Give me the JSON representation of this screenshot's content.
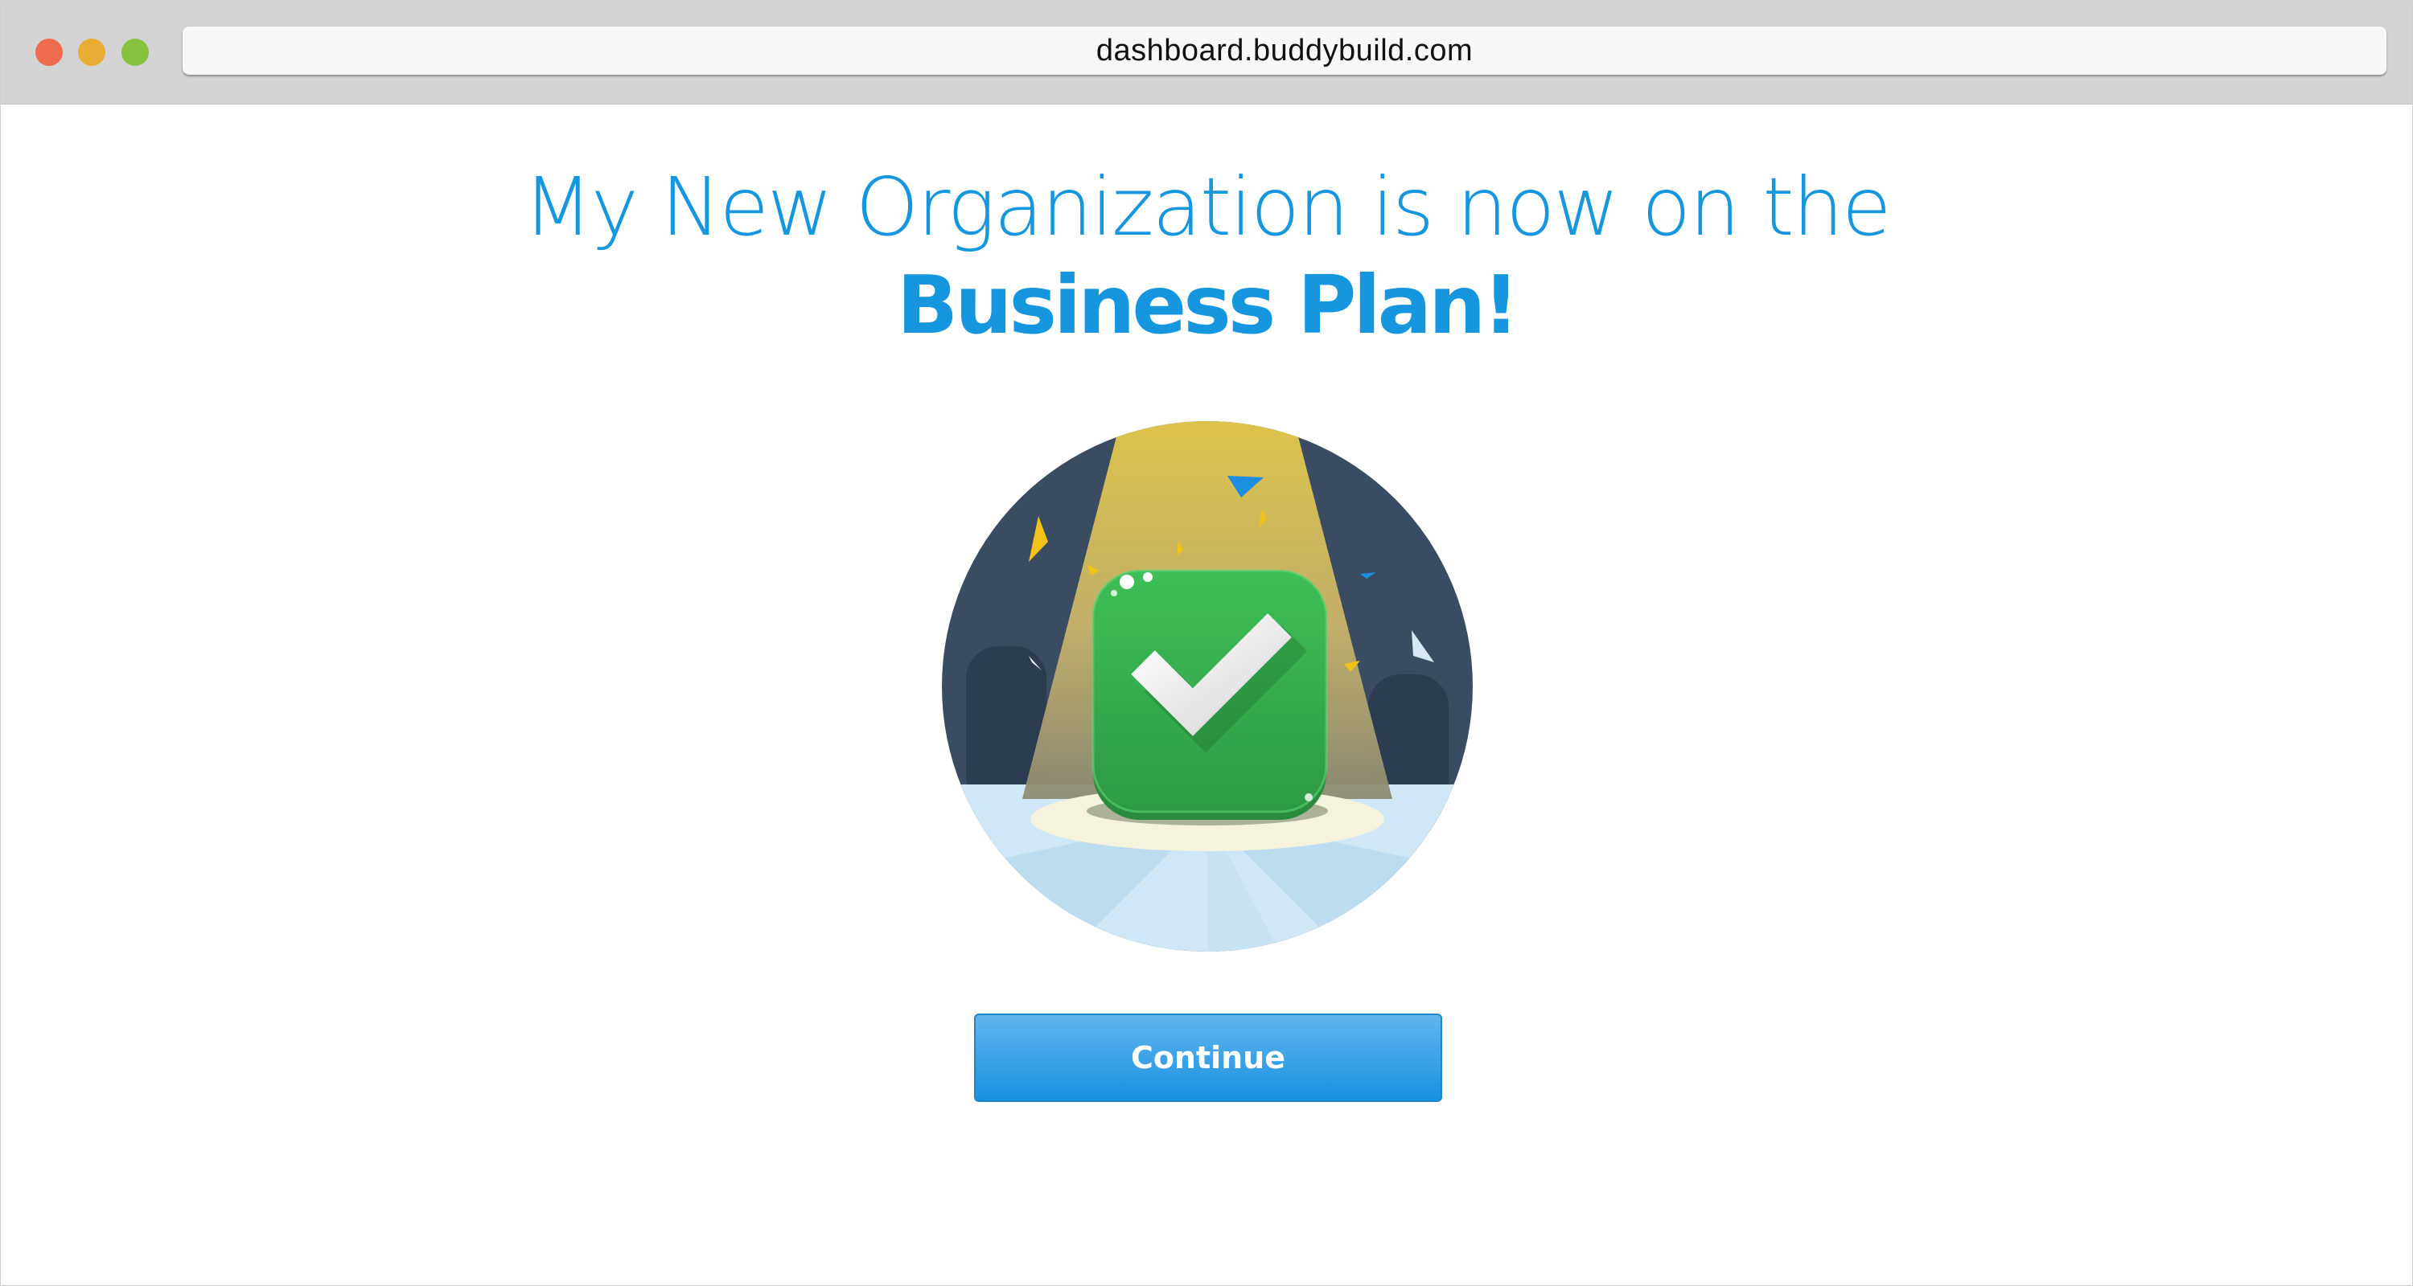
{
  "browser": {
    "url": "dashboard.buddybuild.com"
  },
  "main": {
    "heading_line1": "My New Organization is now on the",
    "heading_line2": "Business Plan!",
    "illustration_icon": "checkmark-badge-icon",
    "continue_label": "Continue"
  },
  "colors": {
    "accent": "#1796e0",
    "button_top": "#62b5ec",
    "button_bottom": "#1891e2",
    "badge_green": "#36b34f"
  }
}
